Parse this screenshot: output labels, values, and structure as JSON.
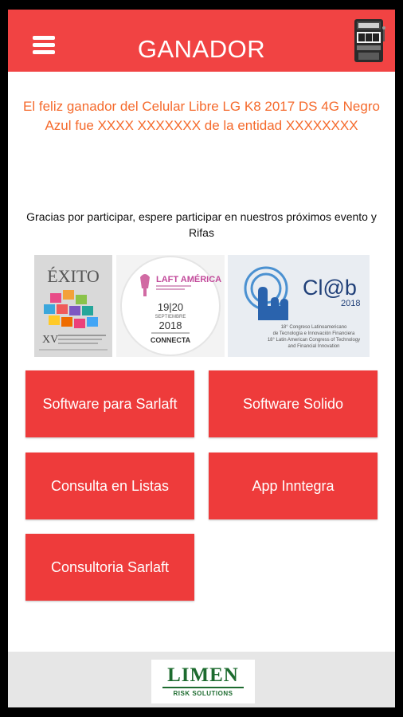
{
  "header": {
    "title": "GANADOR",
    "menu_icon": "hamburger-menu-icon",
    "slot_icon": "slot-machine-icon",
    "bg_color": "#f14343"
  },
  "main": {
    "winner_text": "El feliz ganador del Celular Libre LG K8 2017 DS 4G Negro Azul fue  XXXX XXXXXXX de la entidad XXXXXXXX",
    "thanks_text": "Gracias por participar, espere participar en nuestros próximos evento y Rifas",
    "winner_color": "#f56a2c",
    "banners": [
      {
        "title": "ÉXITO",
        "numeral": "XV"
      },
      {
        "line1": "LAFT AMÉRICA",
        "date": "19|20",
        "month": "SEPTIEMBRE",
        "year": "2018",
        "venue": "CONNECTA"
      },
      {
        "brand": "Cl@b",
        "year": "2018",
        "line1": "18° Congreso Latinoamericano",
        "line2": "de Tecnología e Innovación Financiera",
        "line3": "18° Latin American Congress of Technology",
        "line4": "and Financial Innovation"
      }
    ],
    "buttons": [
      "Software para Sarlaft",
      "Software Solido",
      "Consulta en Listas",
      "App Inntegra",
      "Consultoria Sarlaft"
    ],
    "button_color": "#ee3b3b"
  },
  "footer": {
    "logo_text": "LIMEN",
    "logo_sub": "RISK SOLUTIONS",
    "logo_color": "#1d6b2f"
  }
}
